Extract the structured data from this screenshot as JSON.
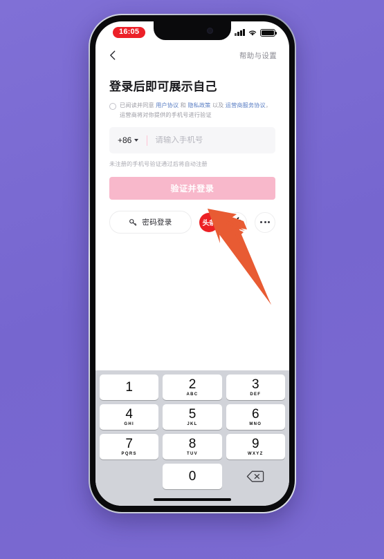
{
  "status_bar": {
    "time": "16:05",
    "signal_icon": "signal-bars-icon",
    "wifi_icon": "wifi-icon",
    "battery_icon": "battery-icon"
  },
  "nav": {
    "back_icon": "back-chevron-icon",
    "help_settings": "帮助与设置"
  },
  "main": {
    "title": "登录后即可展示自己",
    "agreement": {
      "checkbox_checked": false,
      "prefix": "已阅读并同意 ",
      "link1": "用户协议",
      "mid1": " 和 ",
      "link2": "隐私政策",
      "mid2": " 以及 ",
      "link3": "运营商服务协议",
      "suffix": "，运营商将对你提供的手机号进行验证"
    },
    "phone_field": {
      "country_code": "+86",
      "dropdown_icon": "chevron-down-icon",
      "value": "",
      "placeholder": "请输入手机号"
    },
    "hint": "未注册的手机号验证通过后将自动注册",
    "submit_label": "验证并登录",
    "submit_color": "#f8b8cb",
    "password_login": {
      "icon": "key-icon",
      "label": "密码登录"
    },
    "social": [
      {
        "name": "toutiao",
        "label": "头条",
        "color": "#ec2024"
      },
      {
        "name": "apple",
        "label": "",
        "icon": "apple-icon"
      },
      {
        "name": "more",
        "label": "",
        "icon": "ellipsis-icon"
      }
    ]
  },
  "keyboard": {
    "rows": [
      [
        {
          "num": "1",
          "sub": ""
        },
        {
          "num": "2",
          "sub": "ABC"
        },
        {
          "num": "3",
          "sub": "DEF"
        }
      ],
      [
        {
          "num": "4",
          "sub": "GHI"
        },
        {
          "num": "5",
          "sub": "JKL"
        },
        {
          "num": "6",
          "sub": "MNO"
        }
      ],
      [
        {
          "num": "7",
          "sub": "PQRS"
        },
        {
          "num": "8",
          "sub": "TUV"
        },
        {
          "num": "9",
          "sub": "WXYZ"
        }
      ],
      [
        {
          "num": "",
          "sub": "",
          "type": "blank"
        },
        {
          "num": "0",
          "sub": ""
        },
        {
          "num": "",
          "sub": "",
          "type": "delete",
          "icon": "backspace-icon"
        }
      ]
    ]
  },
  "annotation": {
    "arrow_color": "#e85b33",
    "arrow_name": "pointer-arrow-annotation"
  },
  "theme": {
    "background": "#7a6ad2",
    "accent_pink": "#f8b8cb",
    "link_blue": "#5b7fc4",
    "red": "#ec2024"
  }
}
